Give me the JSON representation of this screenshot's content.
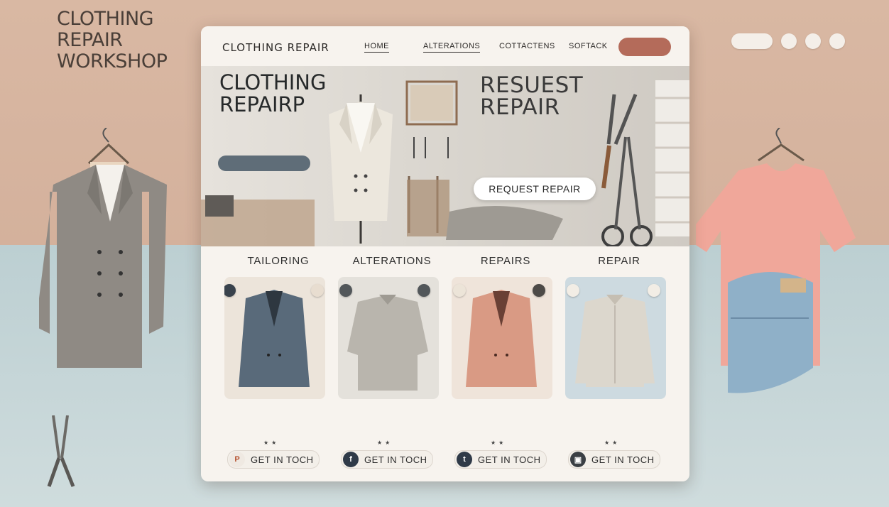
{
  "workshop": {
    "title_lines": [
      "CLOTHING",
      "REPAIR",
      "WORKSHOP"
    ]
  },
  "top_icons": [
    "",
    "",
    "",
    "",
    ""
  ],
  "nav": {
    "brand": "CLOTHING REPAIR",
    "links": [
      "HOME",
      "ALTERATIONS",
      "COTTACTENS",
      "SOFTACK"
    ],
    "cta": ""
  },
  "hero": {
    "title_lines": [
      "CLOTHING",
      "REPAIRP"
    ],
    "text": "",
    "pill": "",
    "request_title_lines": [
      "RESUEST",
      "REPAIR"
    ],
    "request_text": "",
    "request_button": "REQUEST REPAIR"
  },
  "services": [
    {
      "title": "TAILORING",
      "text": "",
      "cta": "GET IN TOCH",
      "icon": "pinterest-icon"
    },
    {
      "title": "ALTERATIONS",
      "text": "",
      "cta": "GET IN TOCH",
      "icon": "facebook-icon"
    },
    {
      "title": "REPAIRS",
      "text": "",
      "cta": "GET IN TOCH",
      "icon": "twitter-icon"
    },
    {
      "title": "REPAIR",
      "text": "",
      "cta": "GET IN TOCH",
      "icon": "message-icon"
    }
  ],
  "colors": {
    "accent": "#b46b5a",
    "card": "#f7f3ee",
    "bg_top": "#d4b19c",
    "bg_bottom": "#c8d8da"
  }
}
